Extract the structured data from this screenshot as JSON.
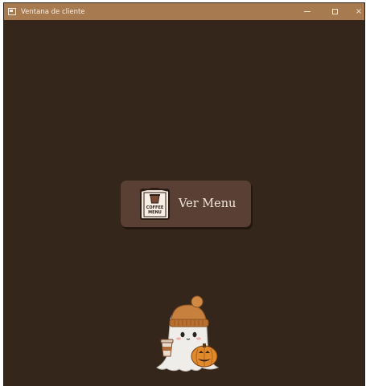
{
  "window": {
    "title": "Ventana de cliente",
    "controls": {
      "minimize": "minimize-icon",
      "maximize": "maximize-icon",
      "close": "×"
    }
  },
  "main": {
    "menu_button": {
      "label": "Ver Menu",
      "icon": "coffee-menu-icon",
      "icon_text_line1": "COFFEE",
      "icon_text_line2": "MENU"
    },
    "mascot": {
      "icon": "ghost-with-coffee-and-pumpkin-illustration"
    }
  },
  "colors": {
    "background": "#34261a",
    "titlebar": "#a87a50",
    "button": "#5a3f35",
    "button_text": "#f1e6dc"
  }
}
